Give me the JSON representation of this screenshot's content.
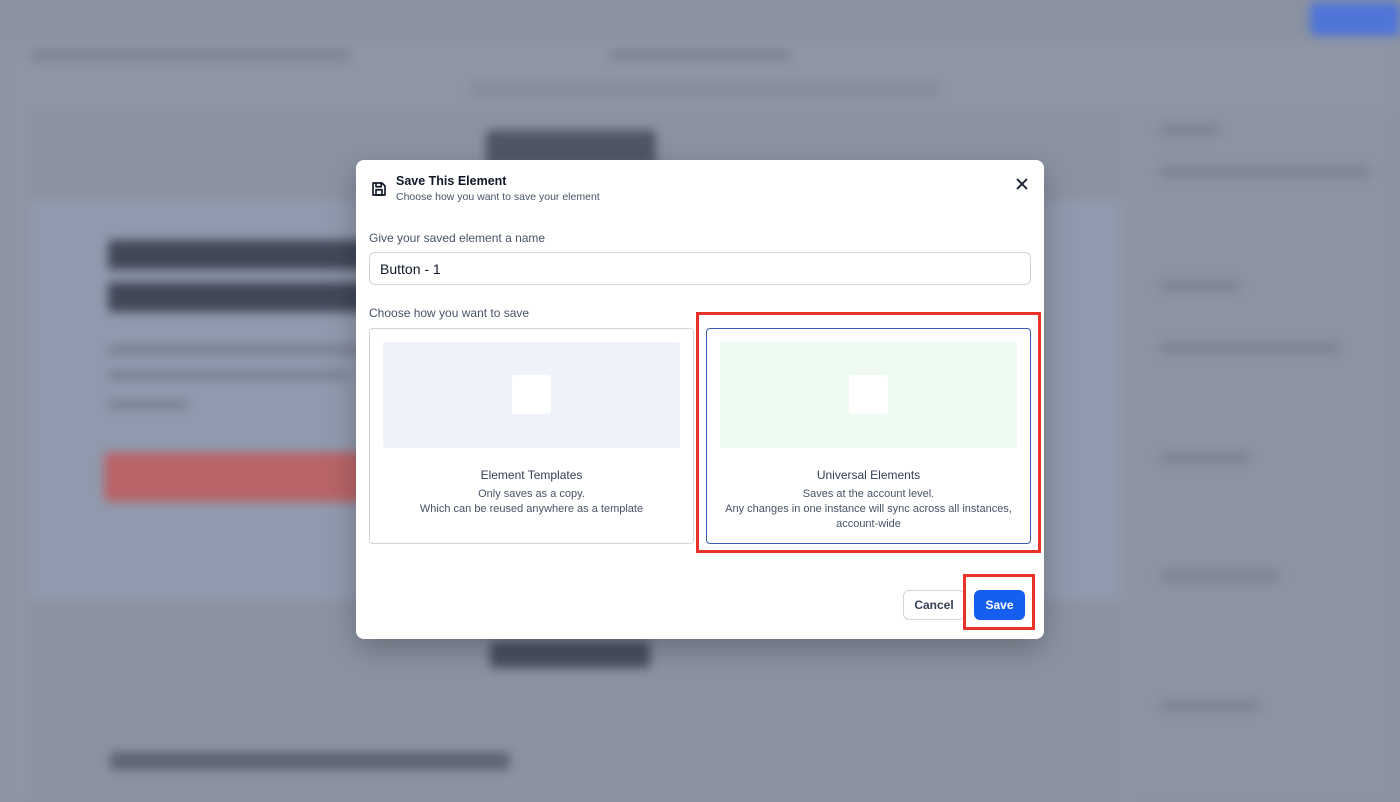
{
  "modal": {
    "title": "Save This Element",
    "subtitle": "Choose how you want to save your element",
    "name_label": "Give your saved element a name",
    "name_value": "Button - 1",
    "choose_label": "Choose how you want to save",
    "options": [
      {
        "title": "Element Templates",
        "desc_line1": "Only saves as a copy.",
        "desc_line2": "Which can be reused anywhere as a template",
        "selected": false
      },
      {
        "title": "Universal Elements",
        "desc_line1": "Saves at the account level.",
        "desc_line2": "Any changes in one instance will sync across all instances,",
        "desc_line3": "account-wide",
        "selected": true
      }
    ],
    "cancel_label": "Cancel",
    "save_label": "Save"
  },
  "icons": {
    "save": "save-icon",
    "close": "close-icon"
  },
  "colors": {
    "primary": "#155eef",
    "highlight": "#e8322a",
    "selected_border": "#3b5bb5"
  }
}
